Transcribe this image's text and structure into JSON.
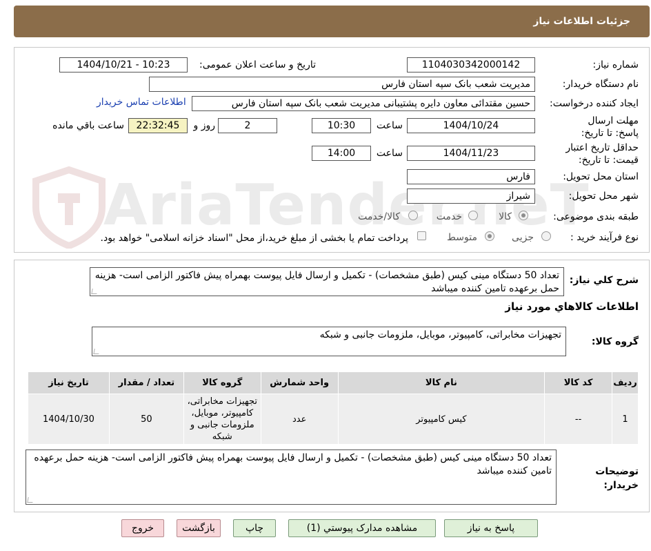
{
  "header": {
    "title": "جزئیات اطلاعات نیاز"
  },
  "form": {
    "need_number_label": "شماره نیاز:",
    "need_number": "1104030342000142",
    "announce_label": "تاریخ و ساعت اعلان عمومی:",
    "announce_value": "1404/10/21 - 10:23",
    "buyer_org_label": "نام دستگاه خریدار:",
    "buyer_org": "مدیریت شعب بانک سپه استان فارس",
    "requester_label": "ایجاد کننده درخواست:",
    "requester": "حسین مقتدائی معاون  دایره پشتیبانی مدیریت شعب بانک سپه استان فارس",
    "contact_link": "اطلاعات تماس خریدار",
    "deadline_label": "مهلت ارسال پاسخ: تا تاریخ:",
    "deadline_date": "1404/10/24",
    "time_label": "ساعت",
    "deadline_time": "10:30",
    "days_count": "2",
    "days_label": "روز و",
    "remaining_time": "22:32:45",
    "remaining_label": "ساعت باقي مانده",
    "validity_label": "حداقل تاریخ اعتبار قیمت: تا تاریخ:",
    "validity_date": "1404/11/23",
    "validity_time": "14:00",
    "province_label": "استان محل تحویل:",
    "province": "فارس",
    "city_label": "شهر محل تحویل:",
    "city": "شیراز",
    "category_label": "طبقه بندی موضوعی:",
    "category_options": [
      "کالا",
      "خدمت",
      "کالا/خدمت"
    ],
    "category_selected": "کالا",
    "process_label": "نوع فرآیند خرید :",
    "process_options": [
      "جزیی",
      "متوسط"
    ],
    "process_selected": "متوسط",
    "payment_note": "پرداخت تمام یا بخشی از مبلغ خرید،از محل \"اسناد خزانه اسلامی\" خواهد بود."
  },
  "details": {
    "summary_label": "شرح کلي نياز:",
    "summary": "تعداد 50 دستگاه مینی کیس (طبق مشخصات) - تکمیل و ارسال فایل پیوست بهمراه پیش فاکتور الزامی است- هزینه حمل برعهده تامین کننده میباشد",
    "goods_info_title": "اطلاعات کالاهاي مورد نياز",
    "goods_group_label": "گروه کالا:",
    "goods_group": "تجهیزات مخابراتی، کامپیوتر، موبایل، ملزومات جانبی و شبکه",
    "table": {
      "headers": [
        "ردیف",
        "کد کالا",
        "نام کالا",
        "واحد شمارش",
        "گروه کالا",
        "تعداد / مقدار",
        "تاریخ نیاز"
      ],
      "rows": [
        [
          "1",
          "--",
          "کیس کامپیوتر",
          "عدد",
          "تجهیزات مخابراتی، کامپیوتر، موبایل، ملزومات جانبی و شبکه",
          "50",
          "1404/10/30"
        ]
      ]
    },
    "buyer_notes_label": "توضیحات خریدار:",
    "buyer_notes": "تعداد 50 دستگاه مینی کیس (طبق مشخصات) - تکمیل و ارسال فایل پیوست بهمراه پیش فاکتور الزامی است- هزینه حمل برعهده تامین کننده میباشد"
  },
  "buttons": {
    "reply": "پاسخ به نیاز",
    "attachments": "مشاهده مدارک پیوستي (1)",
    "print": "چاپ",
    "back": "بازگشت",
    "exit": "خروج"
  },
  "watermark": {
    "text": "AriaTender.neT"
  },
  "colors": {
    "header_bg": "#8b6d4a",
    "link": "#1a3fb0",
    "button_green": "#dff0d8",
    "button_pink": "#f8d7da",
    "highlight": "#f6f3c2"
  }
}
